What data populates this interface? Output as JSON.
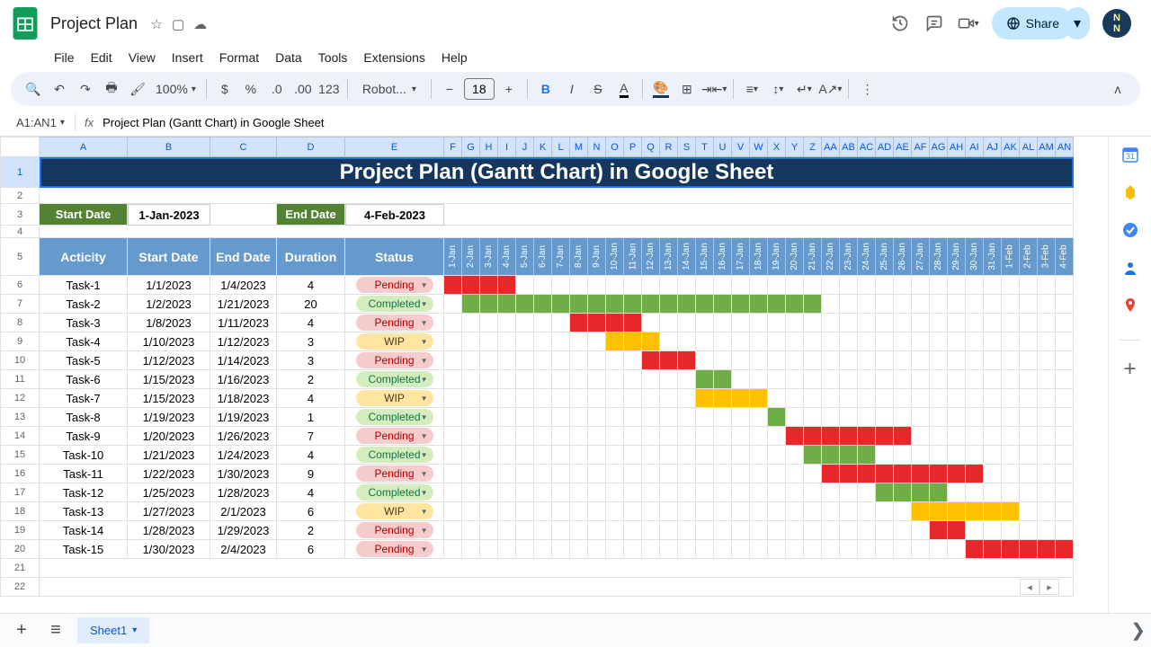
{
  "doc": {
    "title": "Project Plan"
  },
  "menu": [
    "File",
    "Edit",
    "View",
    "Insert",
    "Format",
    "Data",
    "Tools",
    "Extensions",
    "Help"
  ],
  "toolbar": {
    "zoom": "100%",
    "font": "Robot...",
    "fontSize": "18"
  },
  "formula": {
    "ref": "A1:AN1",
    "value": "Project Plan (Gantt Chart) in Google Sheet"
  },
  "share": "Share",
  "cols": [
    "A",
    "B",
    "C",
    "D",
    "E",
    "F",
    "G",
    "H",
    "I",
    "J",
    "K",
    "L",
    "M",
    "N",
    "O",
    "P",
    "Q",
    "R",
    "S",
    "T",
    "U",
    "V",
    "W",
    "X",
    "Y",
    "Z",
    "AA",
    "AB",
    "AC",
    "AD",
    "AE",
    "AF",
    "AG",
    "AH",
    "AI",
    "AJ",
    "AK",
    "AL",
    "AM",
    "AN"
  ],
  "sheet": {
    "title": "Project Plan (Gantt Chart) in Google Sheet",
    "startDateLbl": "Start Date",
    "startDate": "1-Jan-2023",
    "endDateLbl": "End Date",
    "endDate": "4-Feb-2023",
    "headers": [
      "Acticity",
      "Start Date",
      "End Date",
      "Duration",
      "Status"
    ],
    "days": [
      "1-Jan",
      "2-Jan",
      "3-Jan",
      "4-Jan",
      "5-Jan",
      "6-Jan",
      "7-Jan",
      "8-Jan",
      "9-Jan",
      "10-Jan",
      "11-Jan",
      "12-Jan",
      "13-Jan",
      "14-Jan",
      "15-Jan",
      "16-Jan",
      "17-Jan",
      "18-Jan",
      "19-Jan",
      "20-Jan",
      "21-Jan",
      "22-Jan",
      "23-Jan",
      "24-Jan",
      "25-Jan",
      "26-Jan",
      "27-Jan",
      "28-Jan",
      "29-Jan",
      "30-Jan",
      "31-Jan",
      "1-Feb",
      "2-Feb",
      "3-Feb",
      "4-Feb"
    ],
    "tasks": [
      {
        "name": "Task-1",
        "start": "1/1/2023",
        "end": "1/4/2023",
        "dur": "4",
        "status": "Pending",
        "chip": "pending",
        "gs": 0,
        "ge": 4,
        "gc": "g-red"
      },
      {
        "name": "Task-2",
        "start": "1/2/2023",
        "end": "1/21/2023",
        "dur": "20",
        "status": "Completed",
        "chip": "completed",
        "gs": 1,
        "ge": 21,
        "gc": "g-green"
      },
      {
        "name": "Task-3",
        "start": "1/8/2023",
        "end": "1/11/2023",
        "dur": "4",
        "status": "Pending",
        "chip": "pending",
        "gs": 7,
        "ge": 11,
        "gc": "g-red"
      },
      {
        "name": "Task-4",
        "start": "1/10/2023",
        "end": "1/12/2023",
        "dur": "3",
        "status": "WIP",
        "chip": "wip",
        "gs": 9,
        "ge": 12,
        "gc": "g-yellow"
      },
      {
        "name": "Task-5",
        "start": "1/12/2023",
        "end": "1/14/2023",
        "dur": "3",
        "status": "Pending",
        "chip": "pending",
        "gs": 11,
        "ge": 14,
        "gc": "g-red"
      },
      {
        "name": "Task-6",
        "start": "1/15/2023",
        "end": "1/16/2023",
        "dur": "2",
        "status": "Completed",
        "chip": "completed",
        "gs": 14,
        "ge": 16,
        "gc": "g-green"
      },
      {
        "name": "Task-7",
        "start": "1/15/2023",
        "end": "1/18/2023",
        "dur": "4",
        "status": "WIP",
        "chip": "wip",
        "gs": 14,
        "ge": 18,
        "gc": "g-yellow"
      },
      {
        "name": "Task-8",
        "start": "1/19/2023",
        "end": "1/19/2023",
        "dur": "1",
        "status": "Completed",
        "chip": "completed",
        "gs": 18,
        "ge": 19,
        "gc": "g-green"
      },
      {
        "name": "Task-9",
        "start": "1/20/2023",
        "end": "1/26/2023",
        "dur": "7",
        "status": "Pending",
        "chip": "pending",
        "gs": 19,
        "ge": 26,
        "gc": "g-red"
      },
      {
        "name": "Task-10",
        "start": "1/21/2023",
        "end": "1/24/2023",
        "dur": "4",
        "status": "Completed",
        "chip": "completed",
        "gs": 20,
        "ge": 24,
        "gc": "g-green"
      },
      {
        "name": "Task-11",
        "start": "1/22/2023",
        "end": "1/30/2023",
        "dur": "9",
        "status": "Pending",
        "chip": "pending",
        "gs": 21,
        "ge": 30,
        "gc": "g-red"
      },
      {
        "name": "Task-12",
        "start": "1/25/2023",
        "end": "1/28/2023",
        "dur": "4",
        "status": "Completed",
        "chip": "completed",
        "gs": 24,
        "ge": 28,
        "gc": "g-green"
      },
      {
        "name": "Task-13",
        "start": "1/27/2023",
        "end": "2/1/2023",
        "dur": "6",
        "status": "WIP",
        "chip": "wip",
        "gs": 26,
        "ge": 32,
        "gc": "g-yellow"
      },
      {
        "name": "Task-14",
        "start": "1/28/2023",
        "end": "1/29/2023",
        "dur": "2",
        "status": "Pending",
        "chip": "pending",
        "gs": 27,
        "ge": 29,
        "gc": "g-red"
      },
      {
        "name": "Task-15",
        "start": "1/30/2023",
        "end": "2/4/2023",
        "dur": "6",
        "status": "Pending",
        "chip": "pending",
        "gs": 29,
        "ge": 35,
        "gc": "g-red"
      }
    ]
  },
  "tab": "Sheet1"
}
